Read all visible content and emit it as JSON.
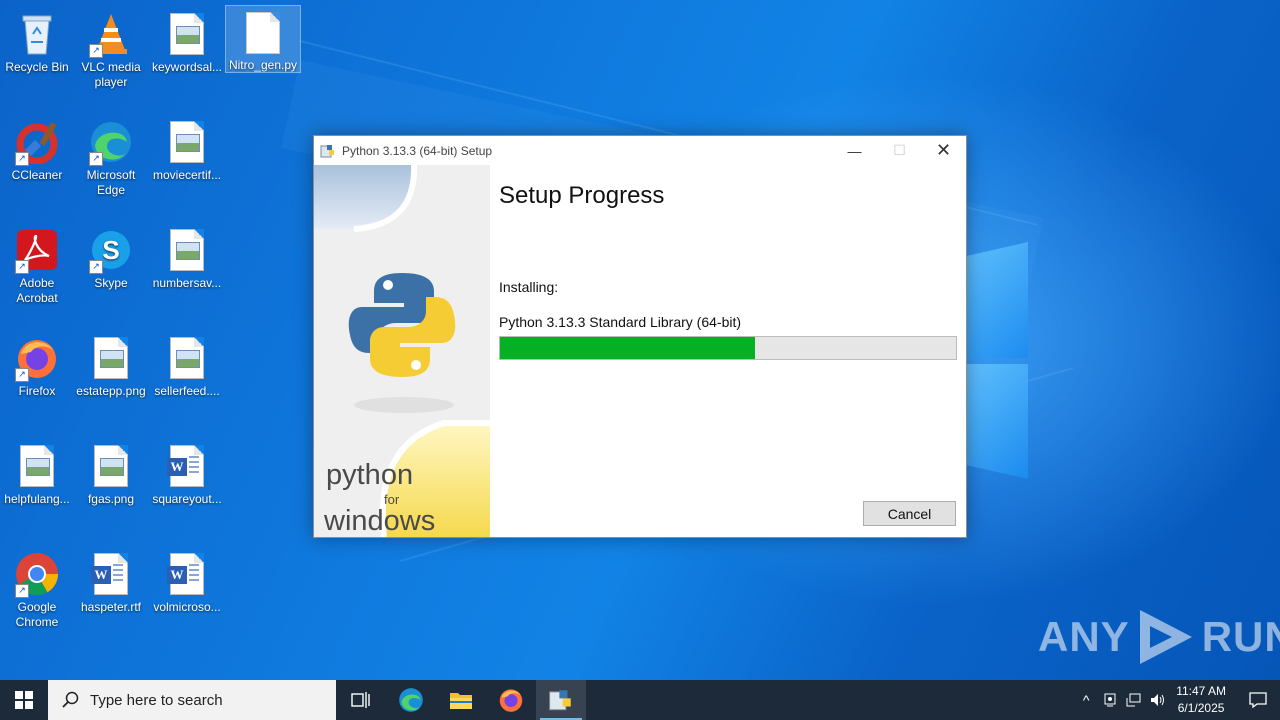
{
  "desktop": {
    "icons": [
      {
        "label": "Recycle Bin",
        "icon": "recycle-bin-icon"
      },
      {
        "label": "VLC media player",
        "icon": "vlc-icon"
      },
      {
        "label": "keywordsal...",
        "icon": "image-file-icon"
      },
      {
        "label": "Nitro_gen.py",
        "icon": "blank-file-icon"
      },
      {
        "label": "CCleaner",
        "icon": "ccleaner-icon"
      },
      {
        "label": "Microsoft Edge",
        "icon": "edge-icon"
      },
      {
        "label": "moviecertif...",
        "icon": "image-file-icon"
      },
      {
        "label": "Adobe Acrobat",
        "icon": "acrobat-icon"
      },
      {
        "label": "Skype",
        "icon": "skype-icon"
      },
      {
        "label": "numbersav...",
        "icon": "image-file-icon"
      },
      {
        "label": "Firefox",
        "icon": "firefox-icon"
      },
      {
        "label": "estatepp.png",
        "icon": "image-file-icon"
      },
      {
        "label": "sellerfeed....",
        "icon": "image-file-icon"
      },
      {
        "label": "helpfulang...",
        "icon": "image-file-icon"
      },
      {
        "label": "fgas.png",
        "icon": "image-file-icon"
      },
      {
        "label": "squareyout...",
        "icon": "word-doc-icon"
      },
      {
        "label": "Google Chrome",
        "icon": "chrome-icon"
      },
      {
        "label": "haspeter.rtf",
        "icon": "word-doc-icon"
      },
      {
        "label": "volmicroso...",
        "icon": "word-doc-icon"
      }
    ]
  },
  "dialog": {
    "title": "Python 3.13.3 (64-bit) Setup",
    "heading": "Setup Progress",
    "status_label": "Installing:",
    "component": "Python 3.13.3 Standard Library (64-bit)",
    "progress_percent": 56,
    "cancel_label": "Cancel",
    "sidebar_text_top": "python",
    "sidebar_text_mid": "for",
    "sidebar_text_bottom": "windows"
  },
  "taskbar": {
    "search_placeholder": "Type here to search",
    "apps": [
      "task-view-icon",
      "edge-icon",
      "file-explorer-icon",
      "firefox-icon",
      "python-setup-icon"
    ],
    "time": "11:47 AM",
    "date": "6/1/2025"
  },
  "watermark": {
    "left": "ANY",
    "right": "RUN"
  },
  "colors": {
    "progress_fill": "#06b025",
    "desktop_blue": "#0a6fd6",
    "taskbar": "#1c2a3a"
  }
}
